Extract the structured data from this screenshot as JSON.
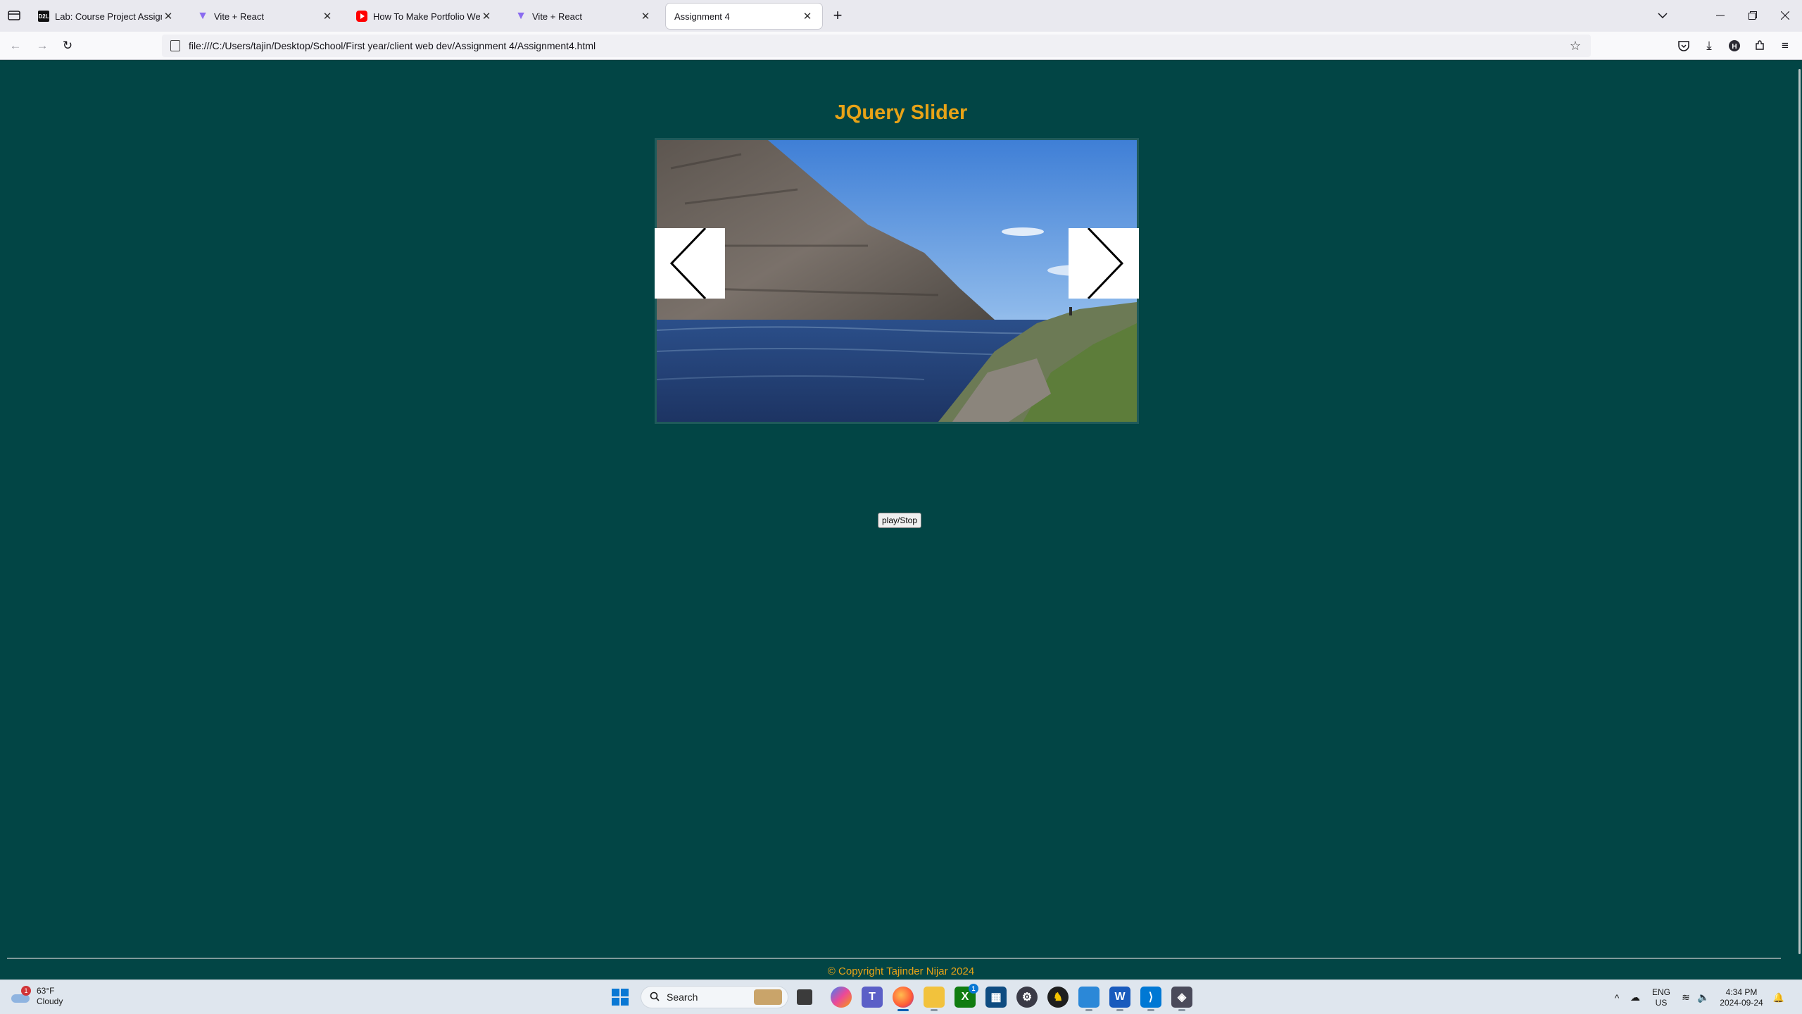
{
  "browser": {
    "tabs": [
      {
        "title": "Lab: Course Project Assignment",
        "favicon": "lab-icon",
        "active": false
      },
      {
        "title": "Vite + React",
        "favicon": "vite-icon",
        "active": false
      },
      {
        "title": "How To Make Portfolio Website",
        "favicon": "youtube-icon",
        "active": false
      },
      {
        "title": "Vite + React",
        "favicon": "vite-icon",
        "active": false
      },
      {
        "title": "Assignment 4",
        "favicon": "",
        "active": true
      }
    ],
    "url": "file:///C:/Users/tajin/Desktop/School/First year/client web dev/Assignment 4/Assignment4.html"
  },
  "page": {
    "heading": "JQuery Slider",
    "slider": {
      "prev_glyph": "<",
      "next_glyph": ">"
    },
    "play_button_label": "play/Stop",
    "footer": "© Copyright Tajinder Nijar 2024"
  },
  "taskbar": {
    "weather": {
      "temp": "63°F",
      "condition": "Cloudy",
      "badge": "1"
    },
    "search_placeholder": "Search",
    "language": {
      "line1": "ENG",
      "line2": "US"
    },
    "clock": {
      "time": "4:34 PM",
      "date": "2024-09-24"
    },
    "store_badge": "1"
  },
  "colors": {
    "page_background": "#024545",
    "heading": "#e8a317",
    "footer_text": "#e8a317"
  }
}
